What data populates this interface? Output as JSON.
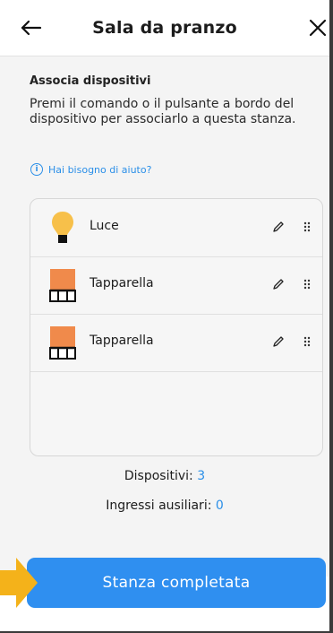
{
  "header": {
    "title": "Sala da pranzo",
    "back_icon": "arrow-left-icon",
    "close_icon": "close-icon"
  },
  "section": {
    "title": "Associa dispositivi",
    "description": "Premi il comando o il pulsante a bordo del dispositivo per associarlo a questa stanza.",
    "help_link": "Hai bisogno di aiuto?",
    "help_icon": "info-icon"
  },
  "devices": [
    {
      "label": "Luce",
      "icon": "lightbulb-icon"
    },
    {
      "label": "Tapparella",
      "icon": "shutter-icon"
    },
    {
      "label": "Tapparella",
      "icon": "shutter-icon"
    }
  ],
  "counts": {
    "devices_label": "Dispositivi:",
    "devices_value": "3",
    "aux_label": "Ingressi ausiliari:",
    "aux_value": "0"
  },
  "cta": {
    "label": "Stanza completata"
  },
  "colors": {
    "accent": "#2f8ff0",
    "link": "#2b8fe8",
    "bulb": "#f7c04a",
    "shutter": "#f08a4b",
    "pointer": "#f4b21a"
  }
}
